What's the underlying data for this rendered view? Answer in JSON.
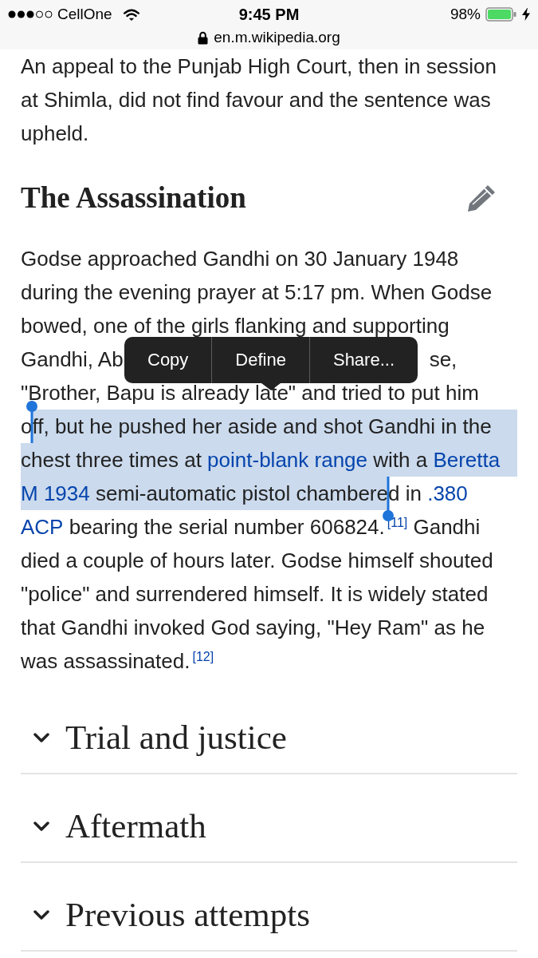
{
  "status_bar": {
    "carrier": "CellOne",
    "time": "9:45 PM",
    "battery": "98%",
    "charging": true
  },
  "address_bar": {
    "url": "en.m.wikipedia.org",
    "secure": true
  },
  "intro_paragraph": {
    "lines": [
      {
        "segments": [
          {
            "kind": "text",
            "text": "An appeal to the Punjab High Court, then in session"
          }
        ]
      },
      {
        "segments": [
          {
            "kind": "text",
            "text": "at Shimla, did not find favour and the sentence was"
          }
        ]
      },
      {
        "segments": [
          {
            "kind": "text",
            "text": "upheld."
          }
        ]
      }
    ]
  },
  "section": {
    "heading": "The Assassination",
    "paragraph": {
      "lines": [
        {
          "segments": [
            {
              "kind": "text",
              "text": "Godse approached Gandhi on 30 January 1948",
              "selected": false
            }
          ]
        },
        {
          "segments": [
            {
              "kind": "text",
              "text": "during the evening prayer at 5:17 pm. When Godse",
              "selected": false
            }
          ]
        },
        {
          "segments": [
            {
              "kind": "text",
              "text": "bowed, one of the girls flanking and supporting",
              "selected": false
            }
          ]
        },
        {
          "segments": [
            {
              "kind": "text",
              "text": "Gandhi, Ab",
              "selected": false
            },
            {
              "kind": "covered"
            },
            {
              "kind": "text",
              "text": "se,",
              "selected": false
            }
          ]
        },
        {
          "segments": [
            {
              "kind": "text",
              "text": "\"Brother, Bapu is already late\" and tried to put him",
              "selected": false
            }
          ]
        },
        {
          "segments": [
            {
              "kind": "text",
              "text": "o",
              "selected": false
            },
            {
              "kind": "text",
              "text": "ff, but he pushed her aside and shot Gandhi in the",
              "selected": true
            }
          ]
        },
        {
          "segments": [
            {
              "kind": "text",
              "text": "chest three times at ",
              "selected": true
            },
            {
              "kind": "link",
              "text": "point-blank range",
              "selected": true
            },
            {
              "kind": "text",
              "text": " with a ",
              "selected": true
            },
            {
              "kind": "link",
              "text": "Beretta",
              "selected": true
            }
          ]
        },
        {
          "segments": [
            {
              "kind": "link",
              "text": "M 1934",
              "selected": true
            },
            {
              "kind": "text",
              "text": " semi-automatic pistol chambere",
              "selected": true
            },
            {
              "kind": "text",
              "text": "d in ",
              "selected": false
            },
            {
              "kind": "link",
              "text": ".380",
              "selected": false
            }
          ]
        },
        {
          "segments": [
            {
              "kind": "link",
              "text": "ACP",
              "selected": false
            },
            {
              "kind": "text",
              "text": " bearing the serial number 606824.",
              "selected": false
            },
            {
              "kind": "ref",
              "text": "[11]"
            },
            {
              "kind": "text",
              "text": " Gandhi",
              "selected": false
            }
          ]
        },
        {
          "segments": [
            {
              "kind": "text",
              "text": "died a couple of hours later. Godse himself shouted",
              "selected": false
            }
          ]
        },
        {
          "segments": [
            {
              "kind": "text",
              "text": "\"police\" and surrendered himself. It is widely stated",
              "selected": false
            }
          ]
        },
        {
          "segments": [
            {
              "kind": "text",
              "text": "that Gandhi invoked God saying, \"Hey Ram\" as he",
              "selected": false
            }
          ]
        },
        {
          "segments": [
            {
              "kind": "text",
              "text": "was assassinated.",
              "selected": false
            },
            {
              "kind": "ref",
              "text": "[12]"
            }
          ]
        }
      ]
    }
  },
  "context_menu": {
    "items": [
      "Copy",
      "Define",
      "Share..."
    ]
  },
  "sections": [
    {
      "title": "Trial and justice",
      "expanded": false
    },
    {
      "title": "Aftermath",
      "expanded": false
    },
    {
      "title": "Previous attempts",
      "expanded": false
    }
  ]
}
